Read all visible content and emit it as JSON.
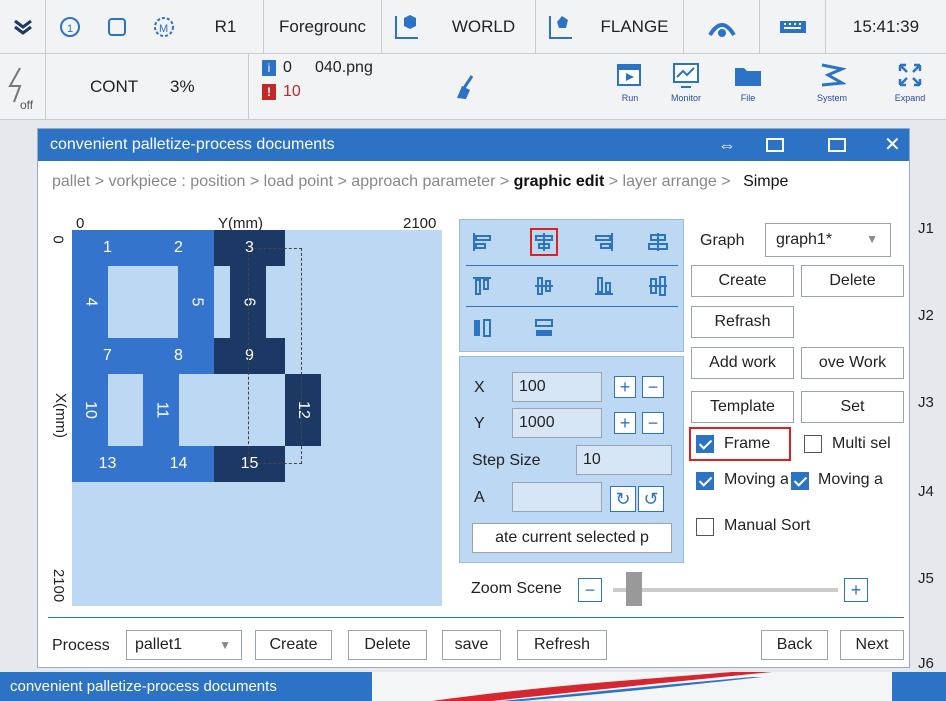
{
  "topbar": {
    "r1": "R1",
    "foreground": "Foregrounc",
    "world": "WORLD",
    "flange": "FLANGE",
    "time": "15:41:39"
  },
  "status": {
    "off": "off",
    "cont": "CONT",
    "percent": "3%",
    "info_count": "0",
    "file": "040.png",
    "warn_count": "10"
  },
  "tools": [
    {
      "label": "Run"
    },
    {
      "label": "Monitor"
    },
    {
      "label": "File"
    },
    {
      "label": "System"
    },
    {
      "label": "Expand"
    }
  ],
  "joints": [
    "J1",
    "J2",
    "J3",
    "J4",
    "J5",
    "J6"
  ],
  "dialog": {
    "title": "convenient palletize-process documents",
    "crumb": {
      "pre": "pallet > vorkpiece : position > load point > approach parameter > ",
      "current": "graphic edit",
      "post": " > layer arrange > ",
      "last": "Simpe"
    },
    "axis": {
      "x0": "0",
      "ylabel": "Y(mm)",
      "xmax": "2100",
      "y0": "0",
      "xlabel": "X(mm)",
      "ymax": "2100"
    },
    "blocks": [
      "1",
      "2",
      "3",
      "4",
      "5",
      "6",
      "7",
      "8",
      "9",
      "10",
      "11",
      "12",
      "13",
      "14",
      "15"
    ],
    "position": {
      "x_label": "X",
      "x_value": "100",
      "y_label": "Y",
      "y_value": "1000",
      "step_label": "Step Size",
      "step_value": "10",
      "a_label": "A",
      "a_value": "",
      "rotate_btn": "ate current selected p"
    },
    "zoom_label": "Zoom Scene",
    "graph": {
      "label": "Graph",
      "selected": "graph1*",
      "create": "Create",
      "delete": "Delete",
      "refresh": "Refrash",
      "add_work": "Add work",
      "remove_work": "ove Work",
      "template": "Template",
      "set": "Set"
    },
    "checks": {
      "frame": "Frame",
      "multi": "Multi sel",
      "moving1": "Moving a",
      "moving2": "Moving a",
      "manual": "Manual Sort"
    },
    "bottom": {
      "process_label": "Process",
      "process_value": "pallet1",
      "create": "Create",
      "delete": "Delete",
      "save": "save",
      "refresh": "Refresh",
      "back": "Back",
      "next": "Next"
    }
  },
  "footer": {
    "title": "convenient palletize-process documents"
  },
  "colors": {
    "accent": "#2c73c6",
    "block": "#3474cc",
    "block_selected": "#1c3966",
    "highlight": "#e02020"
  }
}
